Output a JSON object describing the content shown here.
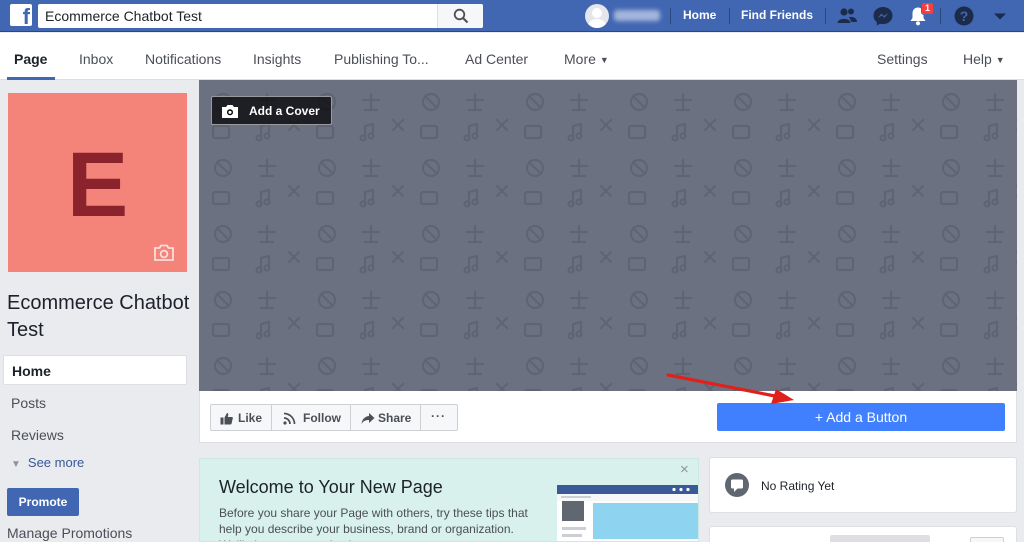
{
  "topbar": {
    "logo": "f",
    "search_value": "Ecommerce Chatbot Test",
    "home_label": "Home",
    "find_friends_label": "Find Friends",
    "notification_count": "1",
    "icons": [
      "search-icon",
      "friend-requests-icon",
      "messenger-icon",
      "notifications-icon",
      "help-icon",
      "account-menu-icon"
    ],
    "bar_color": "#4267b2"
  },
  "pagebar": {
    "tabs": [
      {
        "label": "Page"
      },
      {
        "label": "Inbox"
      },
      {
        "label": "Notifications"
      },
      {
        "label": "Insights"
      },
      {
        "label": "Publishing To..."
      },
      {
        "label": "Ad Center"
      },
      {
        "label": "More"
      }
    ],
    "settings_label": "Settings",
    "help_label": "Help"
  },
  "profile": {
    "initial": "E",
    "page_name": "Ecommerce Chatbot Test",
    "avatar_color": "#f4847a",
    "initial_color": "#8b232d"
  },
  "left_nav": {
    "items": [
      {
        "label": "Home"
      },
      {
        "label": "Posts"
      },
      {
        "label": "Reviews"
      }
    ],
    "see_more": "See more",
    "promote": "Promote",
    "manage_promotions": "Manage Promotions"
  },
  "cover": {
    "add_cover": "Add a Cover"
  },
  "actions": {
    "like": "Like",
    "follow": "Follow",
    "share": "Share",
    "more": "···",
    "add_button": "+ Add a Button",
    "add_button_color": "#4080ff",
    "annotation_arrow_color": "#e0201b"
  },
  "welcome": {
    "title": "Welcome to Your New Page",
    "body": "Before you share your Page with others, try these tips that help you describe your business, brand or organization. We'll give you more tips later.",
    "close": "×",
    "background": "#d8f1ec"
  },
  "rating": {
    "text": "No Rating Yet"
  }
}
